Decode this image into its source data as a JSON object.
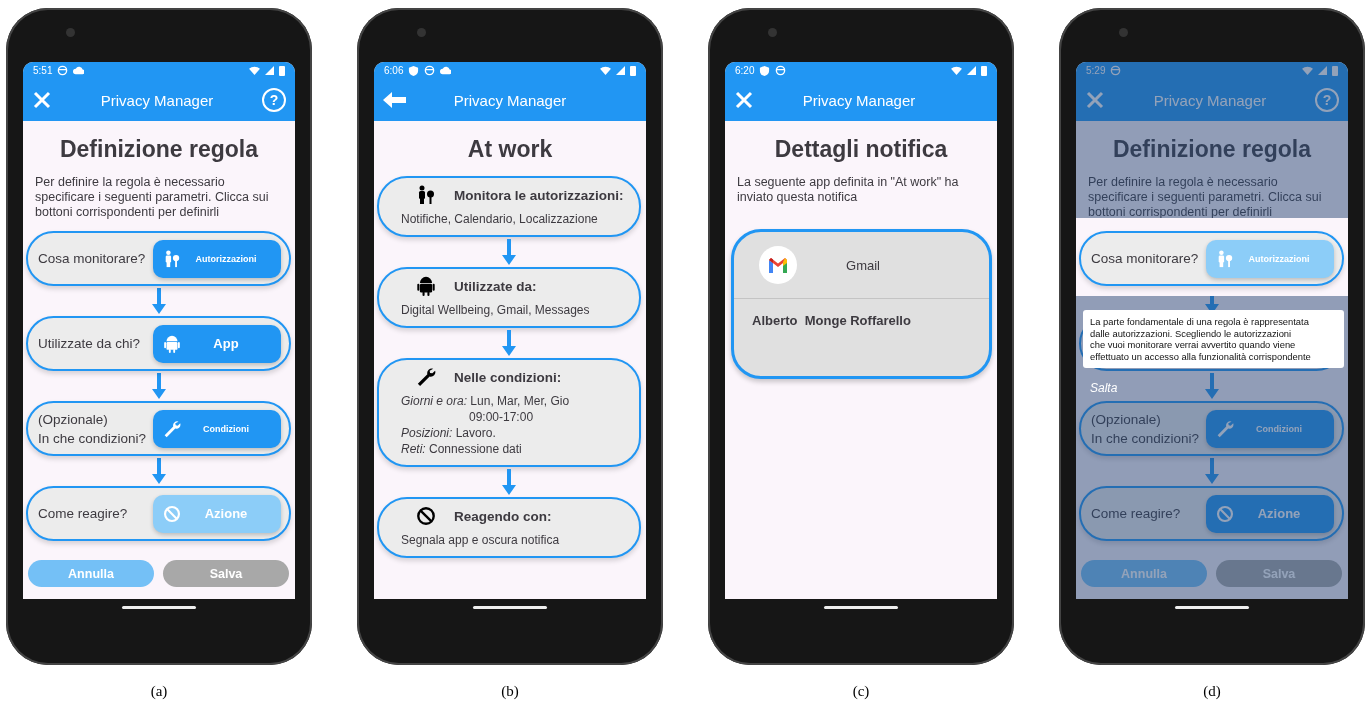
{
  "phones": [
    {
      "kind": "rule",
      "caption": "(a)",
      "status": {
        "time": "5:51"
      },
      "appbar": {
        "title": "Privacy Manager",
        "help": "?"
      },
      "heading": "Definizione regola",
      "intro": "Per definire la regola è necessario specificare i seguenti parametri. Clicca sui bottoni corrispondenti per definirli",
      "steps": [
        {
          "question": "Cosa monitorare?",
          "button": "Autorizzazioni",
          "enabled": true
        },
        {
          "question": "Utilizzate da chi?",
          "button": "App",
          "enabled": true
        },
        {
          "question": "(Opzionale)\nIn che condizioni?",
          "button": "Condizioni",
          "enabled": true
        },
        {
          "question": "Come reagire?",
          "button": "Azione",
          "enabled": false
        }
      ],
      "actions": [
        {
          "label": "Annulla",
          "kind": "cancel"
        },
        {
          "label": "Salva",
          "kind": "save"
        }
      ]
    },
    {
      "kind": "summary",
      "caption": "(b)",
      "status": {
        "time": "6:06"
      },
      "appbar": {
        "title": "Privacy Manager"
      },
      "heading": "At work",
      "cards": [
        {
          "title": "Monitora le autorizzazioni:",
          "lines": [
            {
              "text": "Notifiche, Calendario, Localizzazione",
              "continued": false
            }
          ]
        },
        {
          "title": "Utilizzate da:",
          "lines": [
            {
              "text": "Digital Wellbeing, Gmail, Messages",
              "continued": false
            }
          ]
        },
        {
          "title": "Nelle condizioni:",
          "lines": [
            {
              "text": "*Giorni e ora:* Lun, Mar, Mer, Gio",
              "continued": false
            },
            {
              "text": "09:00-17:00",
              "continued": true
            },
            {
              "text": "*Posizioni:* Lavoro.",
              "continued": false
            },
            {
              "text": "*Reti:* Connessione dati",
              "continued": false
            }
          ]
        },
        {
          "title": "Reagendo con:",
          "lines": [
            {
              "text": "Segnala app e oscura notifica",
              "continued": false
            }
          ]
        }
      ]
    },
    {
      "kind": "notification",
      "caption": "(c)",
      "status": {
        "time": "6:20"
      },
      "appbar": {
        "title": "Privacy Manager"
      },
      "heading": "Dettagli notifica",
      "intro": "La seguente app definita in \"At work\" ha inviato questa notifica",
      "notification": {
        "app": "Gmail",
        "sender": "Alberto  Monge Roffarello"
      }
    },
    {
      "kind": "rule",
      "caption": "(d)",
      "status": {
        "time": "5:29"
      },
      "appbar": {
        "title": "Privacy Manager",
        "help": "?"
      },
      "heading": "Definizione regola",
      "intro": "Per definire la regola è necessario specificare i seguenti parametri. Clicca sui bottoni corrispondenti per definirli",
      "steps": [
        {
          "question": "Cosa monitorare?",
          "button": "Autorizzazioni",
          "enabled": false,
          "highlighted": true
        },
        {
          "covered": true,
          "highlighted": false
        },
        {
          "question": "(Opzionale)\nIn che condizioni?",
          "button": "Condizioni",
          "enabled": true,
          "highlighted": false
        },
        {
          "question": "Come reagire?",
          "button": "Azione",
          "enabled": true,
          "highlighted": false
        }
      ],
      "actions": [
        {
          "label": "Annulla",
          "kind": "cancel"
        },
        {
          "label": "Salva",
          "kind": "save"
        }
      ],
      "tutorial": {
        "text": "La parte fondamentale di una regola è rappresentata\ndalle autorizzazioni. Scegliendo le autorizzazioni\nche vuoi monitorare verrai avvertito quando viene\neffettuato un accesso alla funzionalità corrispondente",
        "skip": "Salta"
      }
    }
  ]
}
